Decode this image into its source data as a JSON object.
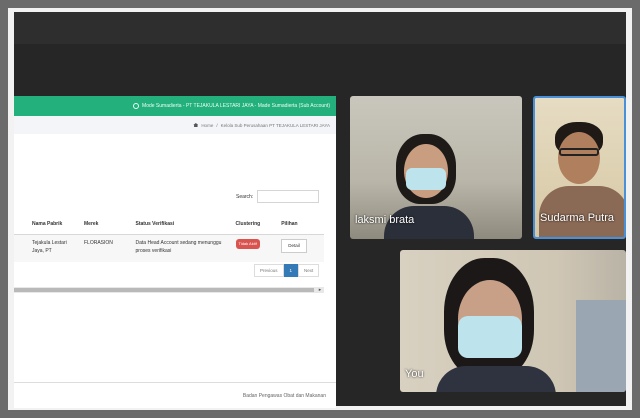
{
  "share": {
    "header_text": "Mode Sumadierta - PT TEJAKULA LESTARI JAYA - Made Sumadierta (Sub Account)",
    "breadcrumb": {
      "home": "Home",
      "current": "Kelola Sub Perusahaan PT TEJAKULA LESTARI JAYA"
    },
    "search_label": "Search:",
    "search_value": "",
    "table": {
      "headers": [
        "Nama Pabrik",
        "Merek",
        "Status Verifikasi",
        "Clustering",
        "Pilihan"
      ],
      "rows": [
        {
          "nama_pabrik": "Tejakula Lestari Jaya, PT",
          "merek": "FLORASION",
          "status": "Data Head Account sedang menunggu proses verifikasi",
          "clustering": "Tidak Aktif",
          "pilihan": "Detail"
        }
      ]
    },
    "pagination": {
      "previous": "Previous",
      "current": "1",
      "next": "Next"
    },
    "footer": "Badan Pengawas Obat dan Makanan"
  },
  "participants": [
    {
      "name": "laksmi brata"
    },
    {
      "name": "Sudarma Putra"
    },
    {
      "name": "You"
    }
  ],
  "colors": {
    "header_green": "#23b07d",
    "active_speaker_border": "#4a90d9",
    "badge_red": "#d9534f"
  }
}
